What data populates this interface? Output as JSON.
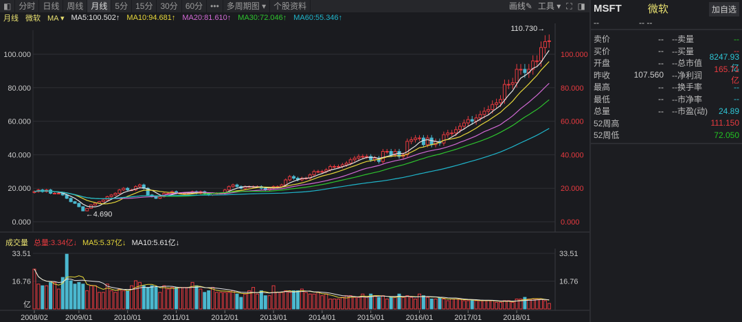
{
  "toolbar": {
    "tabs": [
      "分时",
      "日线",
      "周线",
      "月线",
      "5分",
      "15分",
      "30分",
      "60分",
      "•••",
      "多周期图 ▾",
      "个股资料"
    ],
    "active": "月线",
    "draw": "画线✎",
    "tools": "工具 ▾"
  },
  "header": {
    "period": "月线",
    "name": "微软",
    "ma_select": "MA ▾",
    "ma5": "MA5:100.502↑",
    "ma10": "MA10:94.681↑",
    "ma20": "MA20:81.610↑",
    "ma30": "MA30:72.046↑",
    "ma60": "MA60:55.346↑"
  },
  "volume_header": {
    "label": "成交量",
    "total": "总量:3.34亿↓",
    "ma5": "MA5:5.37亿↓",
    "ma10": "MA10:5.61亿↓"
  },
  "colors": {
    "up": "#e83a3f",
    "down": "#4bb8cf",
    "ma5": "#e6e6e6",
    "ma10": "#e8d83a",
    "ma20": "#d36ad6",
    "ma30": "#2ec42e",
    "ma60": "#1fb6cc"
  },
  "panel": {
    "symbol": "MSFT",
    "name": "微软",
    "add": "加自选",
    "sub1": "--",
    "sub2": "--  --",
    "rows": [
      {
        "l": "卖价",
        "v1": "--",
        "l2": "卖量",
        "v2": "--",
        "c": "gr"
      },
      {
        "l": "买价",
        "v1": "--",
        "l2": "买量",
        "v2": "--",
        "c": "rd"
      },
      {
        "l": "开盘",
        "v1": "--",
        "l2": "总市值",
        "v2": "8247.93亿",
        "c": "cy"
      },
      {
        "l": "昨收",
        "v1": "107.560",
        "l2": "净利润",
        "v2": "165.71亿",
        "c": "rd"
      },
      {
        "l": "最高",
        "v1": "--",
        "l2": "换手率",
        "v2": "--",
        "c": "cy"
      },
      {
        "l": "最低",
        "v1": "--",
        "l2": "市净率",
        "v2": "--",
        "c": "cy"
      },
      {
        "l": "总量",
        "v1": "--",
        "l2": "市盈(动)",
        "v2": "24.89",
        "c": "cy"
      },
      {
        "l": "52周高",
        "v1": "",
        "l2": "",
        "v2": "111.150",
        "c": "rd"
      },
      {
        "l": "52周低",
        "v1": "",
        "l2": "",
        "v2": "72.050",
        "c": "gr"
      }
    ]
  },
  "chart_data": {
    "type": "candlestick",
    "start": "2008/02",
    "interval": "month",
    "y_ticks": [
      "0.000",
      "20.000",
      "40.000",
      "60.000",
      "80.000",
      "100.000"
    ],
    "ylim": [
      0,
      110
    ],
    "x_ticks": [
      "2008/02",
      "2009/01",
      "2010/01",
      "2011/01",
      "2012/01",
      "2013/01",
      "2014/01",
      "2015/01",
      "2016/01",
      "2017/01",
      "2018/01"
    ],
    "max_label": "110.730→",
    "max_value": 110.73,
    "min_label": "←4.690",
    "min_value": 4.69,
    "volume_ticks": [
      "33.51",
      "16.76",
      "亿"
    ],
    "volume_ylim": [
      0,
      33.51
    ],
    "close": [
      18,
      19,
      18,
      19,
      17,
      17,
      17,
      16,
      14,
      12,
      11,
      9,
      6.5,
      8,
      10,
      11,
      12,
      13,
      15,
      16,
      17,
      19,
      20,
      19,
      19,
      21,
      22,
      20,
      16,
      15,
      14,
      15,
      17,
      17,
      18,
      17,
      17,
      17,
      17,
      18,
      17,
      18,
      17,
      16,
      17,
      17,
      17,
      19,
      21,
      22,
      21,
      20,
      21,
      21,
      21,
      21,
      20,
      19,
      20,
      21,
      21,
      22,
      25,
      27,
      26,
      25,
      26,
      26,
      28,
      30,
      30,
      30,
      31,
      33,
      33,
      33,
      34,
      35,
      37,
      38,
      39,
      39,
      39,
      37,
      38,
      36,
      42,
      42,
      40,
      42,
      39,
      40,
      48,
      49,
      50,
      50,
      46,
      50,
      46,
      48,
      47,
      52,
      53,
      53,
      55,
      57,
      59,
      61,
      60,
      62,
      64,
      66,
      67,
      70,
      71,
      73,
      82,
      82,
      83,
      91,
      91,
      89,
      91,
      96,
      96,
      104,
      107.56,
      108
    ],
    "volume": [
      24,
      15,
      14,
      14,
      16,
      16,
      12,
      19,
      33,
      17,
      15,
      16,
      15,
      11,
      14,
      14,
      10,
      10,
      15,
      11,
      10,
      12,
      11,
      11,
      14,
      17,
      16,
      14,
      13,
      14,
      13,
      10,
      14,
      12,
      13,
      13,
      13,
      13,
      13,
      16,
      14,
      12,
      10,
      11,
      13,
      10,
      10,
      10,
      10,
      11,
      9,
      7,
      9,
      11,
      13,
      9,
      11,
      8,
      8,
      14,
      10,
      10,
      11,
      10,
      11,
      11,
      12,
      10,
      9,
      9,
      10,
      8,
      9,
      6,
      6,
      6,
      7,
      8,
      8,
      7,
      7,
      9,
      7,
      9,
      8,
      7,
      8,
      6,
      7,
      7,
      9,
      7,
      8,
      7,
      6,
      9,
      8,
      7,
      6,
      6,
      7,
      6,
      5,
      6,
      6,
      6,
      5,
      5,
      5,
      5,
      5,
      5,
      5,
      5,
      4,
      4,
      5,
      5,
      4,
      6,
      6,
      7,
      6,
      6,
      6,
      6,
      5,
      3.34
    ]
  }
}
